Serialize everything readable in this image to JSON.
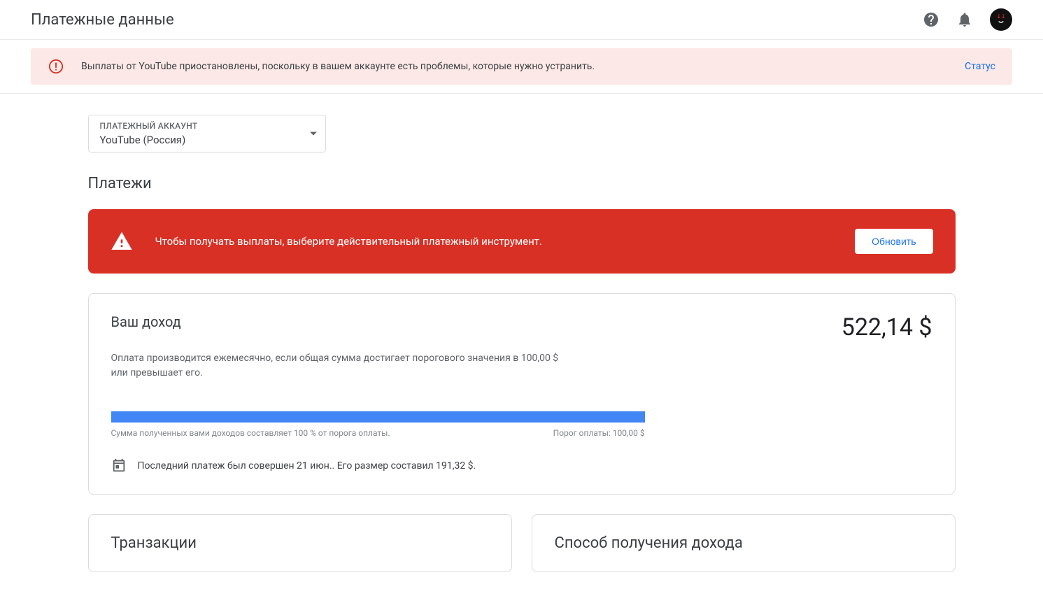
{
  "header": {
    "title": "Платежные данные"
  },
  "warning": {
    "text": "Выплаты от YouTube приостановлены, поскольку в вашем аккаунте есть проблемы, которые нужно устранить.",
    "link": "Статус"
  },
  "account_select": {
    "label": "ПЛАТЕЖНЫЙ АККАУНТ",
    "value": "YouTube (Россия)"
  },
  "section_title": "Платежи",
  "red_alert": {
    "text": "Чтобы получать выплаты, выберите действительный платежный инструмент.",
    "button": "Обновить"
  },
  "earnings": {
    "title": "Ваш доход",
    "amount": "522,14 $",
    "description": "Оплата производится ежемесячно, если общая сумма достигает порогового значения в 100,00 $ или превышает его.",
    "progress_left": "Сумма полученных вами доходов составляет 100 % от порога оплаты.",
    "progress_right": "Порог оплаты: 100,00 $",
    "last_payment": "Последний платеж был совершен 21 июн.. Его размер составил 191,32 $."
  },
  "cards": {
    "transactions_title": "Транзакции",
    "payout_method_title": "Способ получения дохода"
  }
}
